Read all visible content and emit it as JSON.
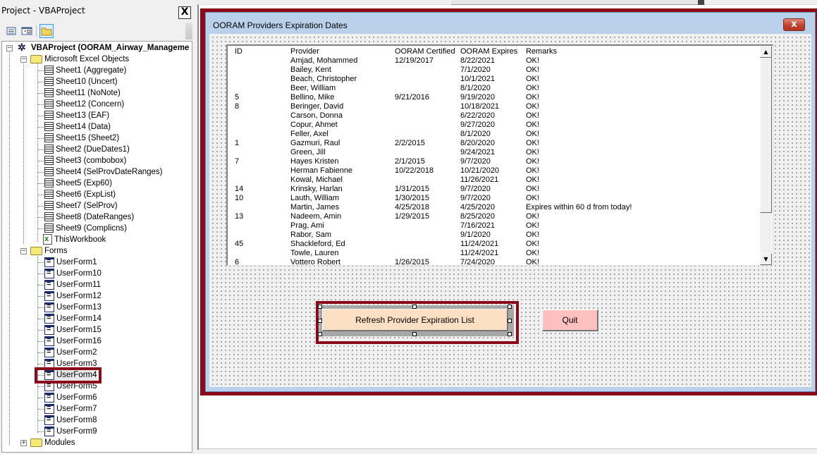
{
  "project_explorer": {
    "title": "Project - VBAProject",
    "close_label": "X",
    "toolbar": [
      {
        "name": "view-code-button",
        "icon": "view-code-icon"
      },
      {
        "name": "view-object-button",
        "icon": "view-object-icon"
      },
      {
        "name": "toggle-folders-button",
        "icon": "folder-icon"
      }
    ],
    "root": "VBAProject (OORAM_Airway_Manageme",
    "groups": {
      "excel_objects": "Microsoft Excel Objects",
      "forms": "Forms",
      "modules": "Modules"
    },
    "sheets": [
      "Sheet1 (Aggregate)",
      "Sheet10 (Uncert)",
      "Sheet11 (NoNote)",
      "Sheet12 (Concern)",
      "Sheet13 (EAF)",
      "Sheet14 (Data)",
      "Sheet15 (Sheet2)",
      "Sheet2 (DueDates1)",
      "Sheet3 (combobox)",
      "Sheet4 (SelProvDateRanges)",
      "Sheet5 (Exp60)",
      "Sheet6 (ExpList)",
      "Sheet7 (SelProv)",
      "Sheet8 (DateRanges)",
      "Sheet9 (Complicns)"
    ],
    "workbook": "ThisWorkbook",
    "forms": [
      "UserForm1",
      "UserForm10",
      "UserForm11",
      "UserForm12",
      "UserForm13",
      "UserForm14",
      "UserForm15",
      "UserForm16",
      "UserForm2",
      "UserForm3",
      "UserForm4",
      "UserForm5",
      "UserForm6",
      "UserForm7",
      "UserForm8",
      "UserForm9"
    ],
    "selected_form": "UserForm4"
  },
  "userform": {
    "caption": "OORAM Providers Expiration Dates",
    "close_label": "x",
    "listbox": {
      "columns": [
        "ID",
        "Provider",
        "OORAM Certified",
        "OORAM Expires",
        "Remarks"
      ],
      "rows": [
        [
          "",
          "Amjad, Mohammed",
          "12/19/2017",
          "8/22/2021",
          "OK!"
        ],
        [
          "",
          "Bailey, Kent",
          "",
          "7/1/2020",
          "OK!"
        ],
        [
          "",
          "Beach, Christopher",
          "",
          "10/1/2021",
          "OK!"
        ],
        [
          "",
          "Beer, William",
          "",
          "8/1/2020",
          "OK!"
        ],
        [
          "5",
          "Bellino, Mike",
          "9/21/2016",
          "9/19/2020",
          "OK!"
        ],
        [
          "8",
          "Beringer, David",
          "",
          "10/18/2021",
          "OK!"
        ],
        [
          "",
          "Carson, Donna",
          "",
          "6/22/2020",
          "OK!"
        ],
        [
          "",
          "Copur, Ahmet",
          "",
          "9/27/2020",
          "OK!"
        ],
        [
          "",
          "Feller, Axel",
          "",
          "8/1/2020",
          "OK!"
        ],
        [
          "1",
          "Gazmuri, Raul",
          "2/2/2015",
          "8/20/2020",
          "OK!"
        ],
        [
          "",
          "Green, Jill",
          "",
          "9/24/2021",
          "OK!"
        ],
        [
          "7",
          "Hayes Kristen",
          "2/1/2015",
          "9/7/2020",
          "OK!"
        ],
        [
          "",
          "Herman Fabienne",
          "10/22/2018",
          "10/21/2020",
          "OK!"
        ],
        [
          "",
          "Kowal, Michael",
          "",
          "11/26/2021",
          "OK!"
        ],
        [
          "14",
          "Krinsky, Harlan",
          "1/31/2015",
          "9/7/2020",
          "OK!"
        ],
        [
          "10",
          "Lauth, William",
          "1/30/2015",
          "9/7/2020",
          "OK!"
        ],
        [
          "",
          "Martin, James",
          "4/25/2018",
          "4/25/2020",
          "Expires within 60 d from today!"
        ],
        [
          "13",
          "Nadeem, Amin",
          "1/29/2015",
          "8/25/2020",
          "OK!"
        ],
        [
          "",
          "Prag, Ami",
          "",
          "7/16/2021",
          "OK!"
        ],
        [
          "",
          "Rabor, Sam",
          "",
          "9/1/2020",
          "OK!"
        ],
        [
          "45",
          "Shackleford, Ed",
          "",
          "11/24/2021",
          "OK!"
        ],
        [
          "",
          "Towle, Lauren",
          "",
          "11/24/2021",
          "OK!"
        ],
        [
          "6",
          "Vottero Robert",
          "1/26/2015",
          "7/24/2020",
          "OK!"
        ]
      ]
    },
    "refresh_button": "Refresh Provider Expiration List",
    "quit_button": "Quit",
    "colors": {
      "refresh_bg": "#fde0c4",
      "quit_bg": "#ffc0c0",
      "highlight": "#8b0a1a"
    }
  }
}
